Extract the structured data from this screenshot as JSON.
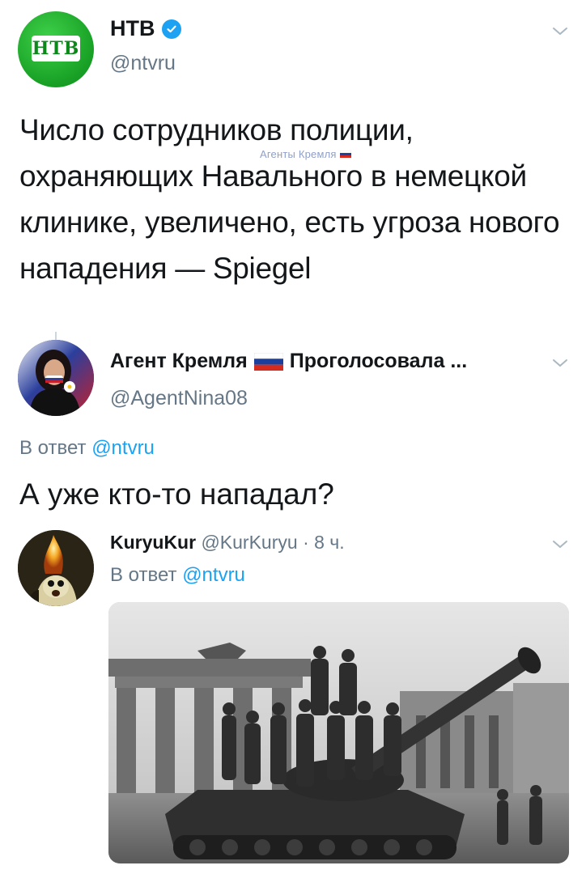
{
  "tweets": [
    {
      "author_name": "НТВ",
      "author_handle": "@ntvru",
      "avatar_text": "НТВ",
      "verified": true,
      "text": "Число сотрудников полиции, охраняющих Навального в немецкой клинике, увеличено, есть угроза нового нападения — Spiegel",
      "watermark": "Агенты Кремля"
    },
    {
      "author_name": "Агент Кремля",
      "author_name_suffix": "Проголосовала ...",
      "author_handle": "@AgentNina08",
      "reply_prefix": "В ответ",
      "reply_mention": "@ntvru",
      "text": "А уже кто-то нападал?"
    },
    {
      "author_name": "KuryuKur",
      "author_handle": "@KurKuryu",
      "time": "· 8 ч.",
      "reply_prefix": "В ответ",
      "reply_mention": "@ntvru",
      "media": "photo"
    }
  ],
  "colors": {
    "text": "#14171a",
    "secondary": "#657786",
    "link": "#1da1f2",
    "ntv_green": "#1aa327"
  },
  "icons": [
    "verified-badge-icon",
    "chevron-down-icon",
    "russia-flag-icon"
  ]
}
